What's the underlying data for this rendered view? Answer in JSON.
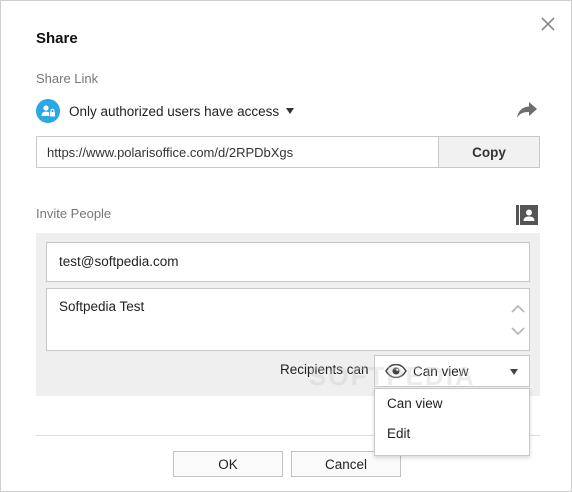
{
  "dialog": {
    "title": "Share",
    "close_icon": "close-icon"
  },
  "share_link": {
    "section_label": "Share Link",
    "access_text": "Only authorized users have access",
    "access_icon": "users-lock-icon",
    "share_icon": "share-arrow-icon",
    "url": "https://www.polarisoffice.com/d/2RPDbXgs",
    "copy_label": "Copy"
  },
  "invite": {
    "section_label": "Invite People",
    "contacts_icon": "contacts-book-icon",
    "email_value": "test@softpedia.com",
    "message_value": "Softpedia Test",
    "recipients_label": "Recipients can",
    "permission_selected": "Can view",
    "permission_options": [
      "Can view",
      "Edit"
    ]
  },
  "buttons": {
    "ok_label": "OK",
    "cancel_label": "Cancel"
  },
  "watermark": "SOFTPEDIA",
  "colors": {
    "accent": "#2aa7e5",
    "panel_bg": "#efefef",
    "border": "#c8c8c8"
  }
}
